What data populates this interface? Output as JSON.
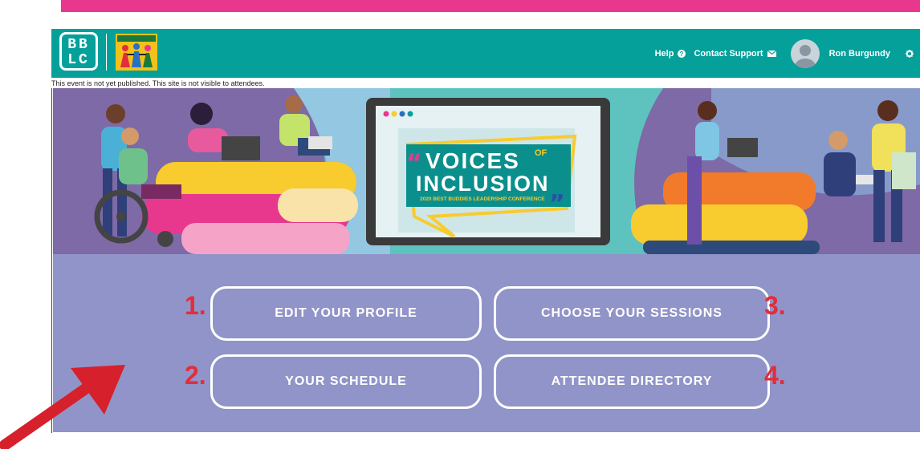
{
  "header": {
    "logo_text_line1": "BB",
    "logo_text_line2": "LC",
    "nav": {
      "help_label": "Help",
      "contact_label": "Contact Support",
      "user_name": "Ron Burgundy"
    }
  },
  "notice": "This event is not yet published. This site is not visible to attendees.",
  "banner": {
    "title_line1": "VOICES",
    "title_of": "OF",
    "title_line2": "INCLUSION",
    "subtitle": "2020 BEST BUDDIES LEADERSHIP CONFERENCE"
  },
  "actions": [
    {
      "number": "1.",
      "label": "EDIT YOUR PROFILE"
    },
    {
      "number": "3.",
      "label": "CHOOSE YOUR SESSIONS"
    },
    {
      "number": "2.",
      "label": "YOUR SCHEDULE"
    },
    {
      "number": "4.",
      "label": "ATTENDEE DIRECTORY"
    }
  ],
  "colors": {
    "accent_pink": "#e8388e",
    "header_teal": "#06a09a",
    "content_purple": "#9194c8",
    "number_red": "#e12e3a"
  }
}
